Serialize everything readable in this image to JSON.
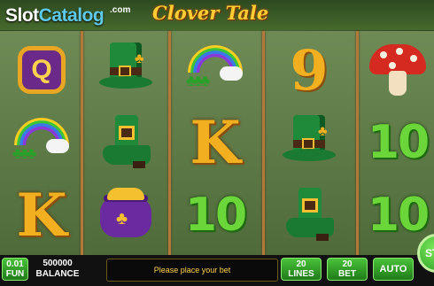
{
  "header": {
    "logo_slot": "Slot",
    "logo_catalog": "Catalog",
    "logo_suffix": ".com",
    "game_title": "Clover Tale"
  },
  "reels": [
    [
      "q",
      "rainbow",
      "k"
    ],
    [
      "hat",
      "boot",
      "pot"
    ],
    [
      "rainbow",
      "k",
      "10"
    ],
    [
      "9",
      "hat",
      "boot"
    ],
    [
      "mushroom",
      "10",
      "10"
    ]
  ],
  "symbol_text": {
    "k": "K",
    "nine": "9",
    "ten": "10",
    "q": "Q"
  },
  "footer": {
    "fun_value": "0.01",
    "fun_label": "FUN",
    "balance_value": "500000",
    "balance_label": "BALANCE",
    "message": "Please place your bet",
    "lines_value": "20",
    "lines_label": "LINES",
    "bet_value": "20",
    "bet_label": "BET",
    "auto_label": "AUTO",
    "spin_label": "ST"
  }
}
